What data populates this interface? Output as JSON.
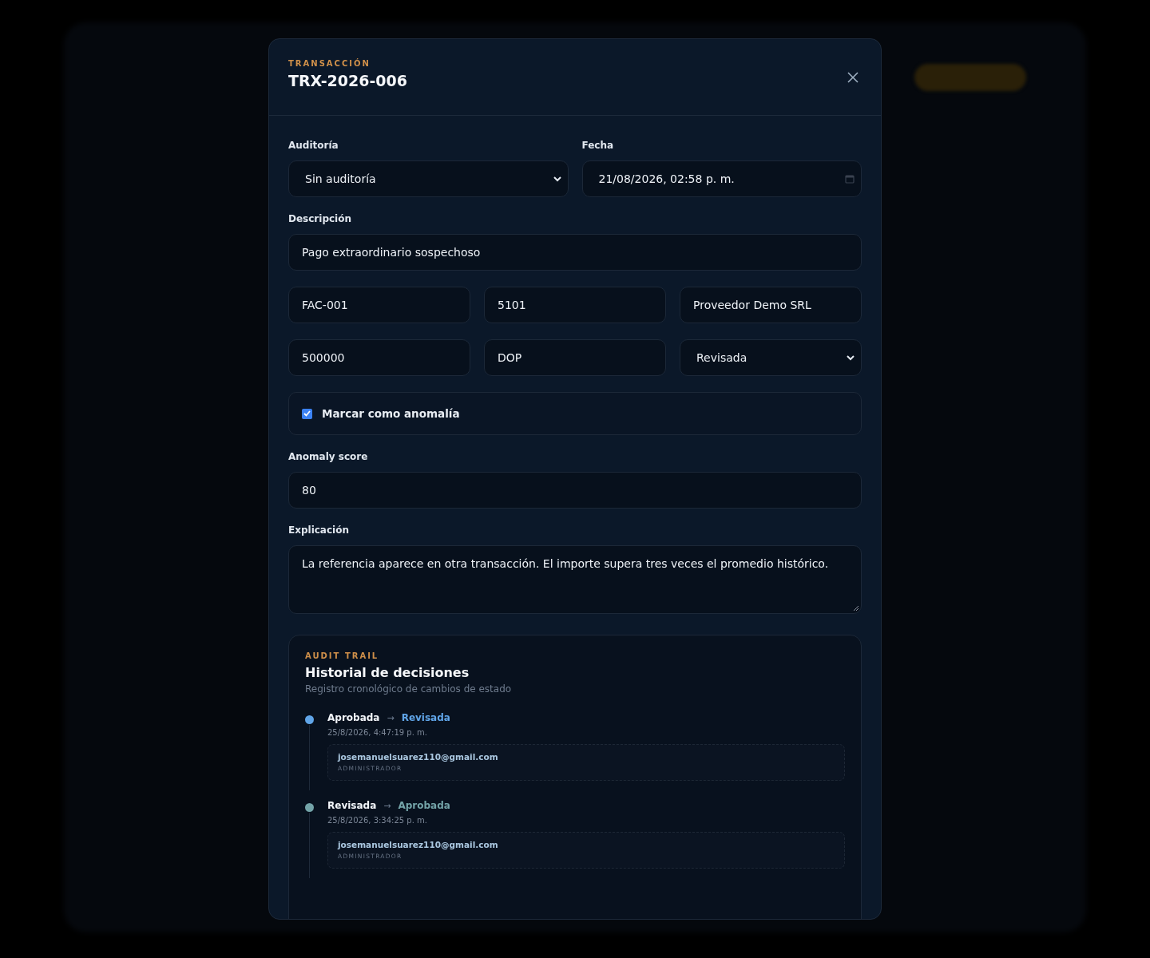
{
  "modal": {
    "eyebrow": "TRANSACCIÓN",
    "title": "TRX-2026-006"
  },
  "form": {
    "audit": {
      "label": "Auditoría",
      "value": "Sin auditoría"
    },
    "date": {
      "label": "Fecha",
      "value": "21/08/2026, 02:58 p. m."
    },
    "description": {
      "label": "Descripción",
      "value": "Pago extraordinario sospechoso"
    },
    "reference": {
      "value": "FAC-001"
    },
    "account": {
      "value": "5101"
    },
    "vendor": {
      "value": "Proveedor Demo SRL"
    },
    "amount": {
      "value": "500000"
    },
    "currency": {
      "value": "DOP"
    },
    "status": {
      "value": "Revisada"
    },
    "anomaly": {
      "label": "Marcar como anomalía",
      "checked": true
    },
    "score": {
      "label": "Anomaly score",
      "value": "80"
    },
    "explanation": {
      "label": "Explicación",
      "value": "La referencia aparece en otra transacción. El importe supera tres veces el promedio histórico."
    }
  },
  "audit_trail": {
    "eyebrow": "AUDIT TRAIL",
    "title": "Historial de decisiones",
    "subtitle": "Registro cronológico de cambios de estado",
    "entries": [
      {
        "from": "Aprobada",
        "arrow": "→",
        "to": "Revisada",
        "time": "25/8/2026, 4:47:19 p. m.",
        "user": "josemanuelsuarez110@gmail.com",
        "role": "ADMINISTRADOR",
        "color": "#60a5e8"
      },
      {
        "from": "Revisada",
        "arrow": "→",
        "to": "Aprobada",
        "time": "25/8/2026, 3:34:25 p. m.",
        "user": "josemanuelsuarez110@gmail.com",
        "role": "ADMINISTRADOR",
        "color": "#73a3a8"
      }
    ]
  }
}
